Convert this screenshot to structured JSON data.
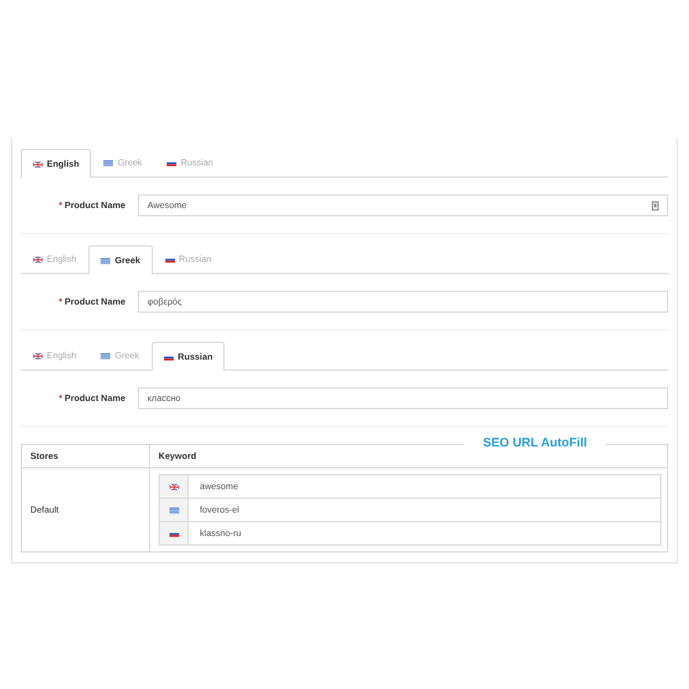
{
  "panels": [
    {
      "tabs": [
        {
          "label": "English",
          "kind": "uk",
          "selected": true
        },
        {
          "label": "Greek",
          "kind": "gr",
          "selected": false
        },
        {
          "label": "Russian",
          "kind": "ru",
          "selected": false
        }
      ],
      "field": {
        "required_mark": "*",
        "label": "Product Name",
        "value": "Awesome",
        "addon_icon": true
      }
    },
    {
      "tabs": [
        {
          "label": "English",
          "kind": "uk",
          "selected": false
        },
        {
          "label": "Greek",
          "kind": "gr",
          "selected": true
        },
        {
          "label": "Russian",
          "kind": "ru",
          "selected": false
        }
      ],
      "field": {
        "required_mark": "*",
        "label": "Product Name",
        "value": "φοβερός",
        "addon_icon": false
      }
    },
    {
      "tabs": [
        {
          "label": "English",
          "kind": "uk",
          "selected": false
        },
        {
          "label": "Greek",
          "kind": "gr",
          "selected": false
        },
        {
          "label": "Russian",
          "kind": "ru",
          "selected": true
        }
      ],
      "field": {
        "required_mark": "*",
        "label": "Product Name",
        "value": "классно",
        "addon_icon": false
      }
    }
  ],
  "overlay_label": "SEO URL AutoFill",
  "table": {
    "columns": [
      "Stores",
      "Keyword"
    ],
    "rows": [
      {
        "store": "Default",
        "keywords": [
          {
            "kind": "uk",
            "value": "awesome"
          },
          {
            "kind": "gr",
            "value": "foveros-el"
          },
          {
            "kind": "ru",
            "value": "klassno-ru"
          }
        ]
      }
    ]
  }
}
